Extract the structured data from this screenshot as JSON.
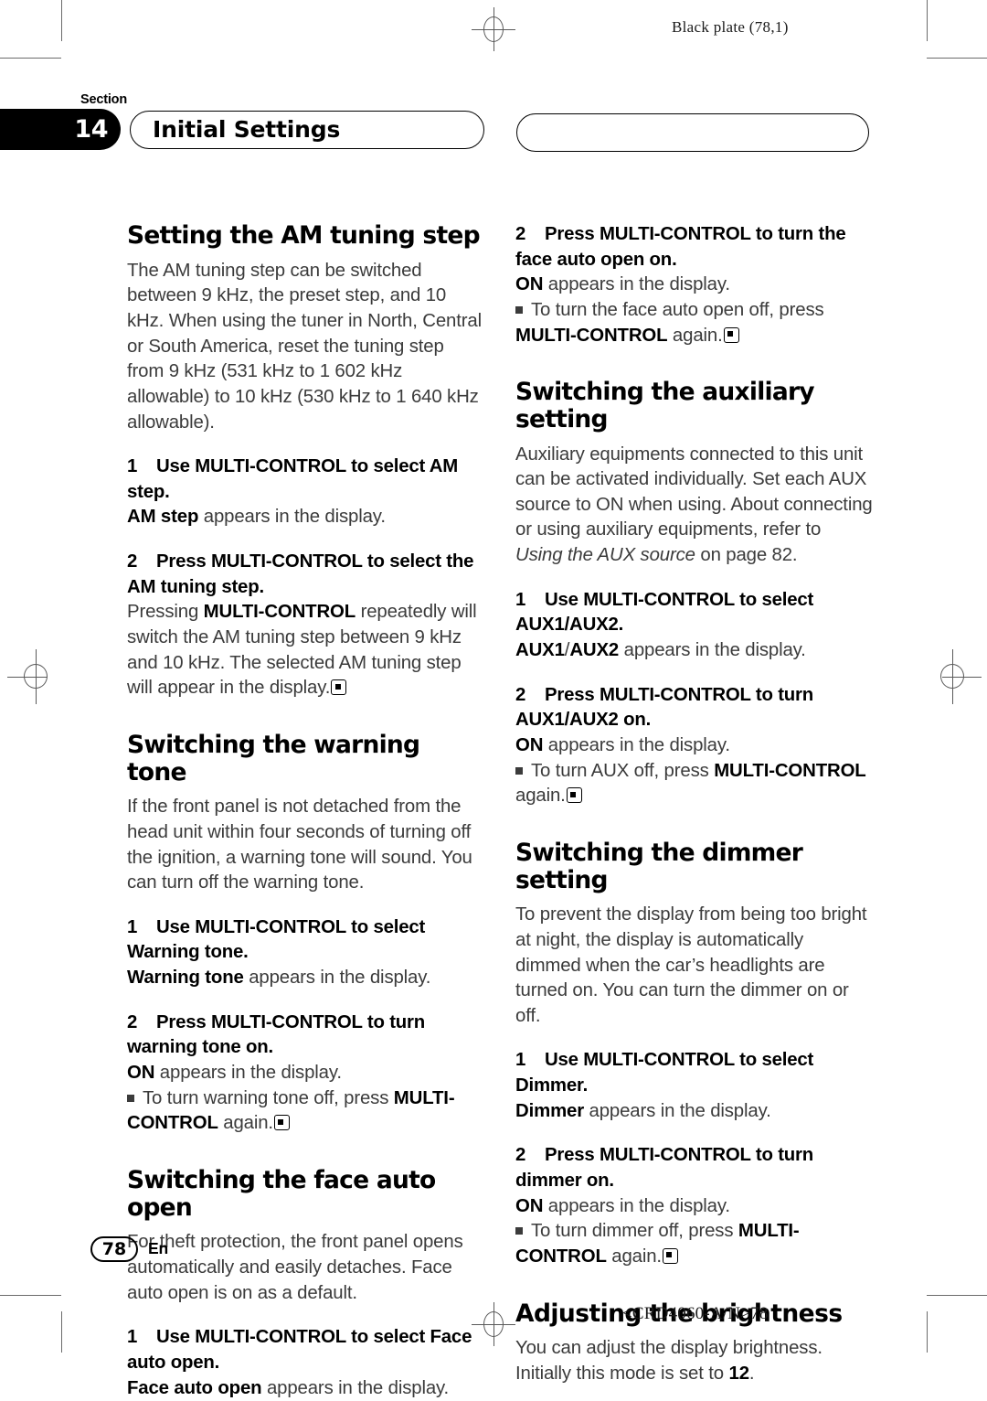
{
  "print_marks": {
    "plate_label": "Black plate (78,1)",
    "doc_code": "<CRD4060-A/N>78"
  },
  "header": {
    "section_word": "Section",
    "section_number": "14",
    "title": "Initial Settings",
    "right_pill_title": ""
  },
  "footer": {
    "page_number": "78",
    "language": "En"
  },
  "left_column": {
    "section1": {
      "heading": "Setting the AM tuning step",
      "intro": "The AM tuning step can be switched between 9 kHz, the preset step, and 10 kHz. When using the tuner in North, Central or South America, reset the tuning step from 9 kHz (531 kHz to 1 602 kHz allowable) to 10 kHz (530 kHz to 1 640 kHz allowable).",
      "step1_num": "1",
      "step1_text": "Use MULTI-CONTROL to select AM step.",
      "step1_result_bold": "AM step",
      "step1_result_rest": " appears in the display.",
      "step2_num": "2",
      "step2_text": "Press MULTI-CONTROL to select the AM tuning step.",
      "step2_result_a": "Pressing ",
      "step2_result_b": "MULTI-CONTROL",
      "step2_result_c": " repeatedly will switch the AM tuning step between 9 kHz and 10 kHz. The selected AM tuning step will appear in the display."
    },
    "section2": {
      "heading": "Switching the warning tone",
      "intro": "If the front panel is not detached from the head unit within four seconds of turning off the ignition, a warning tone will sound. You can turn off the warning tone.",
      "step1_num": "1",
      "step1_text": "Use MULTI-CONTROL to select Warning tone.",
      "step1_result_bold": "Warning tone",
      "step1_result_rest": " appears in the display.",
      "step2_num": "2",
      "step2_text": "Press MULTI-CONTROL to turn warning tone on.",
      "step2_result_bold": "ON",
      "step2_result_rest": " appears in the display.",
      "note_a": "To turn warning tone off, press ",
      "note_b": "MULTI-CONTROL",
      "note_c": " again."
    },
    "section3": {
      "heading": "Switching the face auto open",
      "intro": "For theft protection, the front panel opens automatically and easily detaches. Face auto open is on as a default.",
      "step1_num": "1",
      "step1_text": "Use MULTI-CONTROL to select Face auto open.",
      "step1_result_bold": "Face auto open",
      "step1_result_rest": " appears in the display."
    }
  },
  "right_column": {
    "continued_step": {
      "num": "2",
      "text": "Press MULTI-CONTROL to turn the face auto open on.",
      "result_bold": "ON",
      "result_rest": " appears in the display.",
      "note_a": "To turn the face auto open off, press ",
      "note_b": "MULTI-CONTROL",
      "note_c": " again."
    },
    "section4": {
      "heading": "Switching the auxiliary setting",
      "intro_a": "Auxiliary equipments connected to this unit can be activated individually. Set each AUX source to ON when using. About connecting or using auxiliary equipments, refer to ",
      "intro_italic": "Using the AUX source",
      "intro_b": " on page 82.",
      "step1_num": "1",
      "step1_text": "Use MULTI-CONTROL to select AUX1/AUX2.",
      "step1_result_b1": "AUX1",
      "step1_result_slash": "/",
      "step1_result_b2": "AUX2",
      "step1_result_rest": " appears in the display.",
      "step2_num": "2",
      "step2_text": "Press MULTI-CONTROL to turn AUX1/AUX2 on.",
      "step2_result_bold": "ON",
      "step2_result_rest": " appears in the display.",
      "note_a": "To turn AUX off, press ",
      "note_b": "MULTI-CONTROL",
      "note_c": " again."
    },
    "section5": {
      "heading": "Switching the dimmer setting",
      "intro": "To prevent the display from being too bright at night, the display is automatically dimmed when the car’s headlights are turned on. You can turn the dimmer on or off.",
      "step1_num": "1",
      "step1_text": "Use MULTI-CONTROL to select Dimmer.",
      "step1_result_bold": "Dimmer",
      "step1_result_rest": " appears in the display.",
      "step2_num": "2",
      "step2_text": "Press MULTI-CONTROL to turn dimmer on.",
      "step2_result_bold": "ON",
      "step2_result_rest": " appears in the display.",
      "note_a": "To turn dimmer off, press ",
      "note_b": "MULTI-CONTROL",
      "note_c": " again."
    },
    "section6": {
      "heading": "Adjusting the brightness",
      "intro_a": "You can adjust the display brightness. Initially this mode is set to ",
      "intro_bold": "12",
      "intro_b": "."
    }
  }
}
